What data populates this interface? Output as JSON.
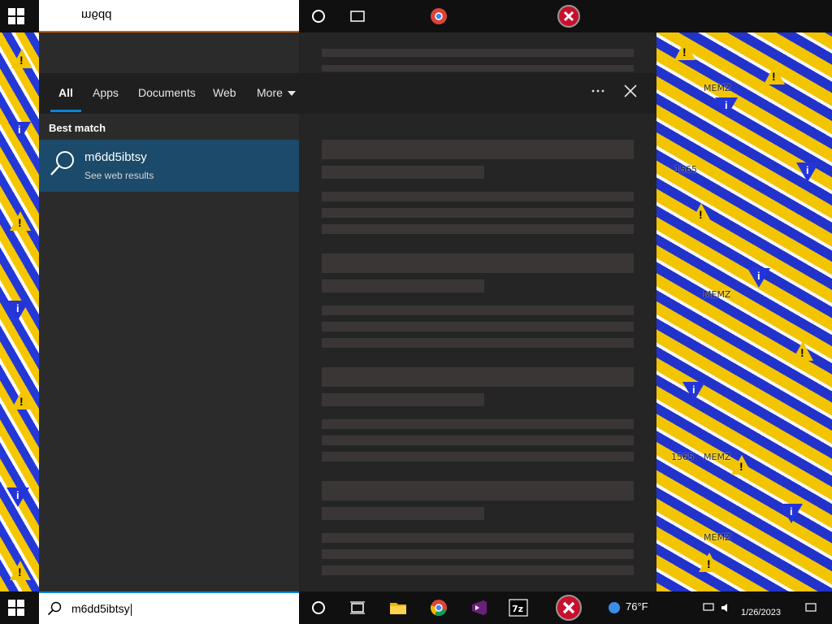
{
  "top_glitch": {
    "search_text": "m6dd"
  },
  "search_panel": {
    "tabs": [
      {
        "label": "All"
      },
      {
        "label": "Apps"
      },
      {
        "label": "Documents"
      },
      {
        "label": "Web"
      },
      {
        "label": "More"
      }
    ],
    "options_icon": "ellipsis-icon",
    "close_icon": "close-icon",
    "best_match_heading": "Best match",
    "best_match": {
      "title": "m6dd5ibtsy",
      "subtitle": "See web results",
      "icon": "search-icon"
    }
  },
  "taskbar": {
    "search_value": "m6dd5ibtsy",
    "weather": "76°F",
    "clock": "1/26/2023",
    "icons": [
      "windows-start-icon",
      "search-icon",
      "cortana-icon",
      "task-view-icon",
      "file-explorer-icon",
      "chrome-icon",
      "visual-studio-icon",
      "7zip-icon",
      "error-icon",
      "weather-icon",
      "network-icon",
      "volume-icon",
      "notification-icon"
    ]
  },
  "background": {
    "ghost_labels": [
      "MEMZ",
      "MEMZ",
      "1565",
      "MEMZ",
      "1565",
      "MEMZ"
    ]
  },
  "colors": {
    "accent": "#0a84d6",
    "selected_row": "#1b4a6a",
    "panel": "#2b2b2b",
    "warning_yellow": "#f3c500",
    "info_blue": "#2335d8"
  }
}
